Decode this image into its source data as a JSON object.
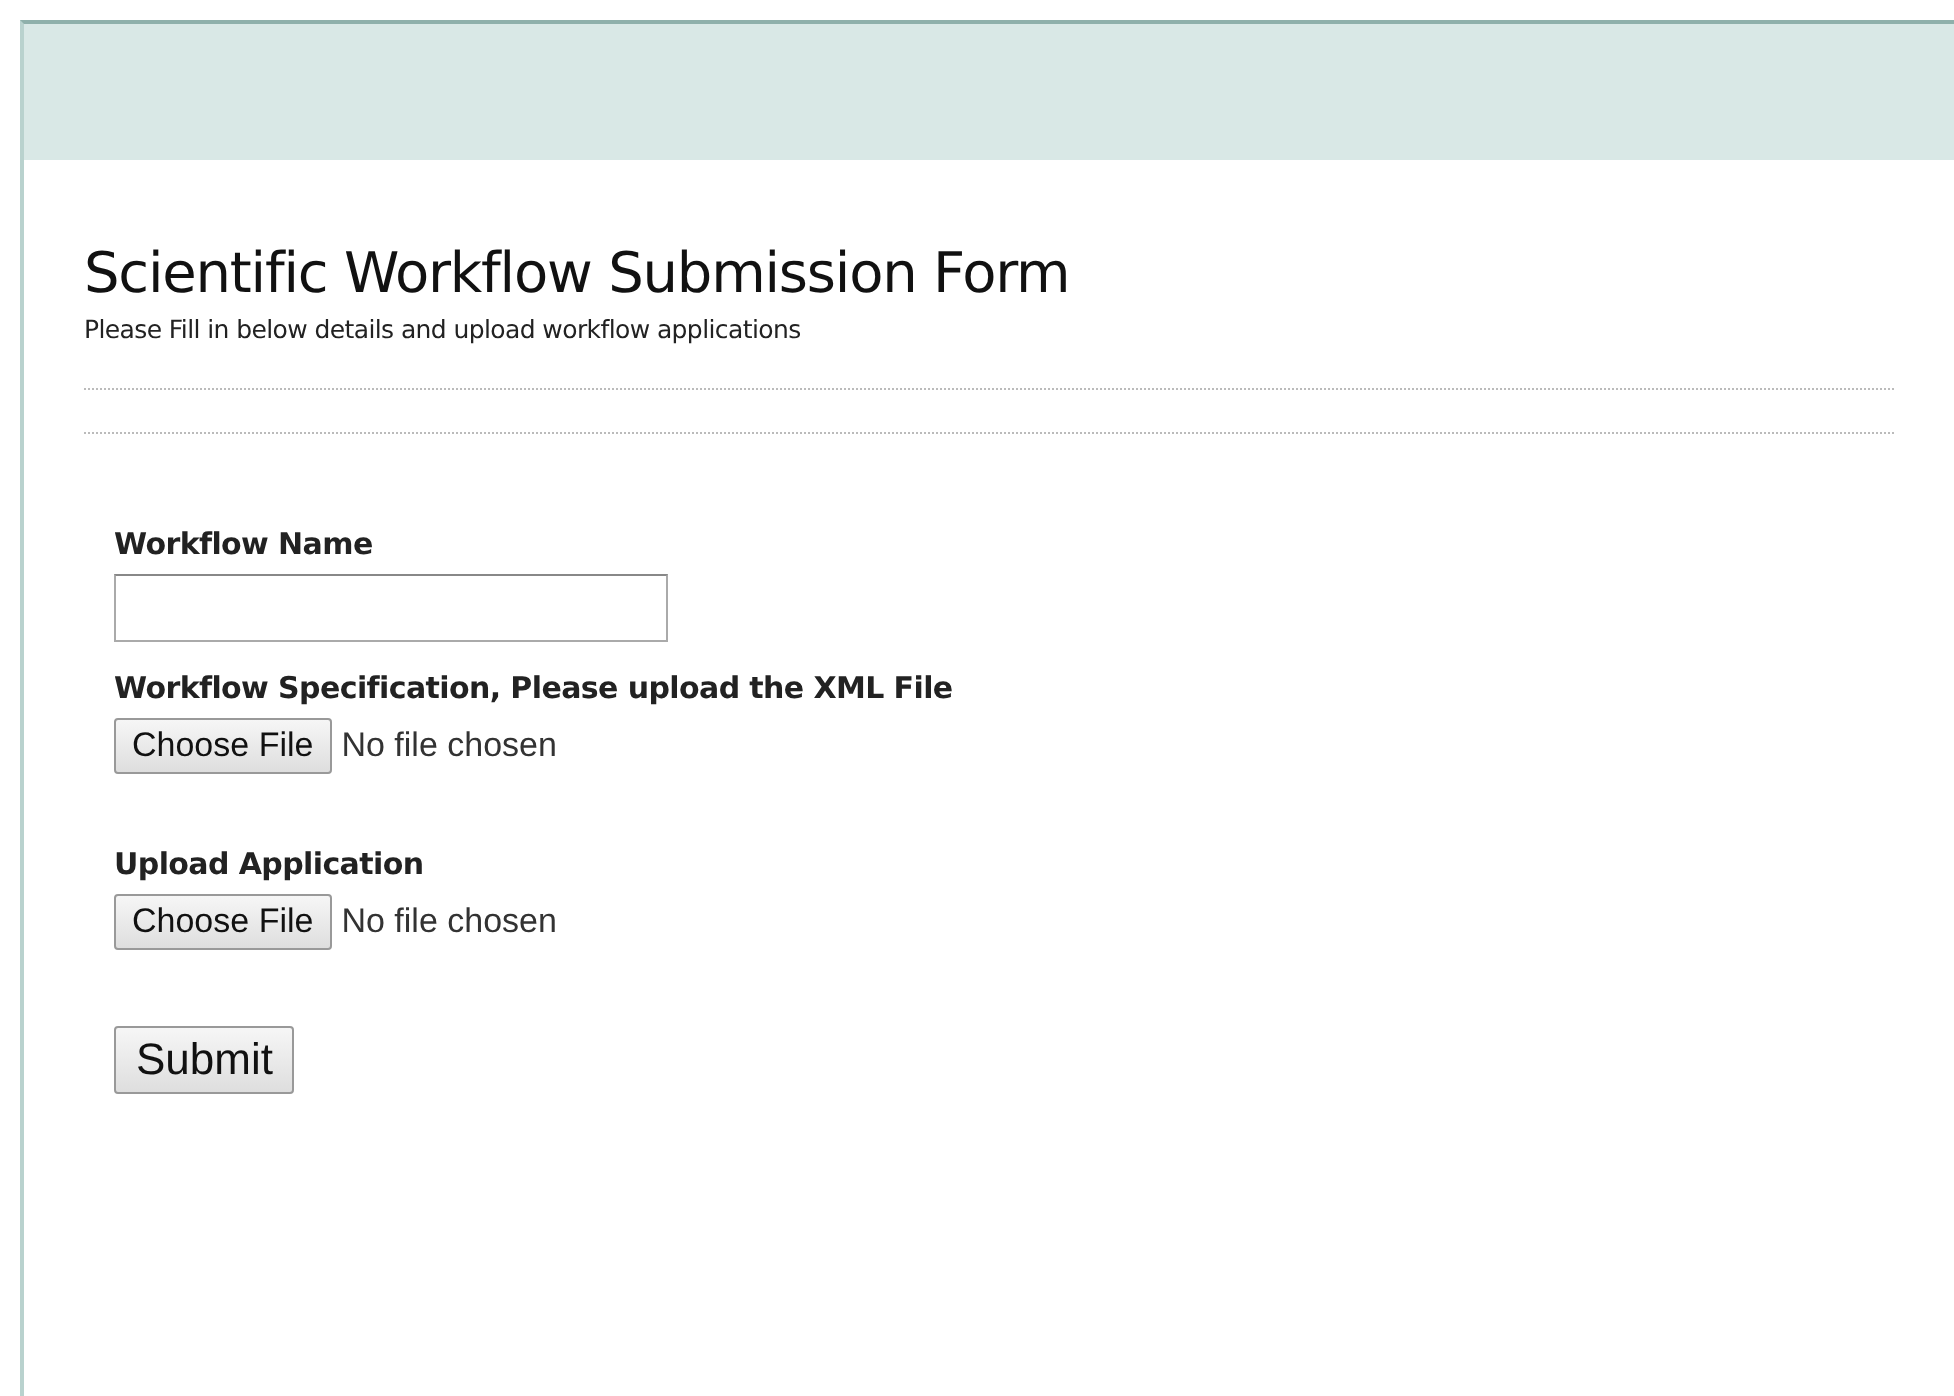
{
  "title": "Scientific Workflow Submission Form",
  "subtitle": "Please Fill in below details and upload workflow applications",
  "fields": [
    {
      "kind": "text",
      "label": "Workflow Name"
    },
    {
      "kind": "file",
      "label": "Workflow Specification, Please upload the XML File",
      "button": "Choose File",
      "status": "No file chosen"
    },
    {
      "kind": "file",
      "label": "Upload Application",
      "button": "Choose File",
      "status": "No file chosen"
    }
  ],
  "submit": "Submit"
}
